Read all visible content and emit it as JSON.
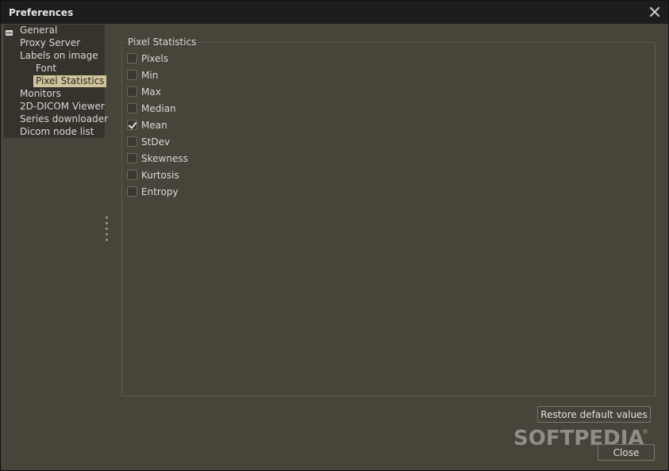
{
  "window": {
    "title": "Preferences"
  },
  "sidebar": {
    "items": [
      {
        "label": "General"
      },
      {
        "label": "Proxy Server"
      },
      {
        "label": "Labels on image"
      },
      {
        "label": "Font"
      },
      {
        "label": "Pixel Statistics",
        "selected": true
      },
      {
        "label": "Monitors"
      },
      {
        "label": "2D-DICOM Viewer"
      },
      {
        "label": "Series downloader"
      },
      {
        "label": "Dicom node list"
      }
    ]
  },
  "main": {
    "group_title": "Pixel Statistics",
    "options": [
      {
        "label": "Pixels",
        "checked": false
      },
      {
        "label": "Min",
        "checked": false
      },
      {
        "label": "Max",
        "checked": false
      },
      {
        "label": "Median",
        "checked": false
      },
      {
        "label": "Mean",
        "checked": true
      },
      {
        "label": "StDev",
        "checked": false
      },
      {
        "label": "Skewness",
        "checked": false
      },
      {
        "label": "Kurtosis",
        "checked": false
      },
      {
        "label": "Entropy",
        "checked": false
      }
    ]
  },
  "buttons": {
    "restore_label": "Restore default values",
    "close_label": "Close"
  },
  "watermark": {
    "text": "SOFTPEDIA",
    "mark": "®"
  }
}
